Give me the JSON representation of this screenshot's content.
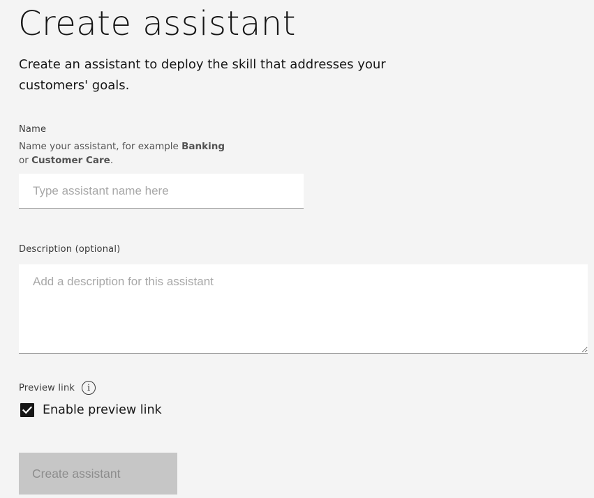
{
  "page": {
    "title": "Create assistant",
    "subtitle": "Create an assistant to deploy the skill that addresses your customers' goals."
  },
  "name_field": {
    "label": "Name",
    "helper_prefix": "Name your assistant, for example ",
    "helper_bold_1": "Banking",
    "helper_middle": "or ",
    "helper_bold_2": "Customer Care",
    "helper_suffix": ".",
    "value": "",
    "placeholder": "Type assistant name here"
  },
  "description_field": {
    "label": "Description (optional)",
    "value": "",
    "placeholder": "Add a description for this assistant"
  },
  "preview_link": {
    "label": "Preview link",
    "info_icon": "info-icon",
    "checkbox_label": "Enable preview link",
    "checked": true
  },
  "actions": {
    "create_label": "Create assistant",
    "disabled": true
  },
  "colors": {
    "background": "#f4f4f4",
    "field_background": "#ffffff",
    "text_primary": "#161616",
    "placeholder": "#a8a8a8",
    "button_disabled_bg": "#c6c6c6",
    "button_disabled_text": "#8d8d8d"
  }
}
